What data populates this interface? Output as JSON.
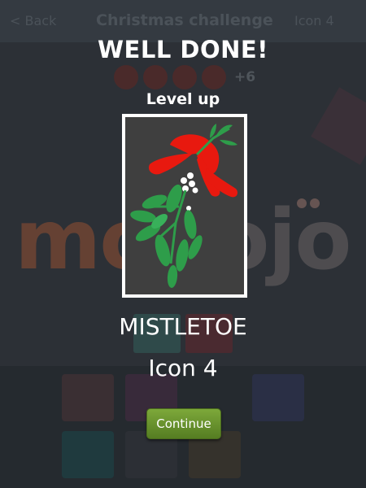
{
  "header": {
    "back_label": "< Back",
    "title": "Christmas challenge",
    "level_label": "Icon 4"
  },
  "hint": {
    "bonus_label": "+6"
  },
  "modal": {
    "headline": "WELL DONE!",
    "subtitle": "Level up",
    "icon": "mistletoe-icon",
    "answer": "MISTLETOE",
    "level": "Icon 4",
    "continue_label": "Continue"
  },
  "watermark": {
    "part1": "mo",
    "part2": "dojo"
  },
  "colors": {
    "overlay_bg": "#2c3036",
    "card_bg": "#3f3f3f",
    "ribbon_red": "#e8190f",
    "leaf_green": "#2e9d4a",
    "button_green": "#6b9a2e"
  }
}
